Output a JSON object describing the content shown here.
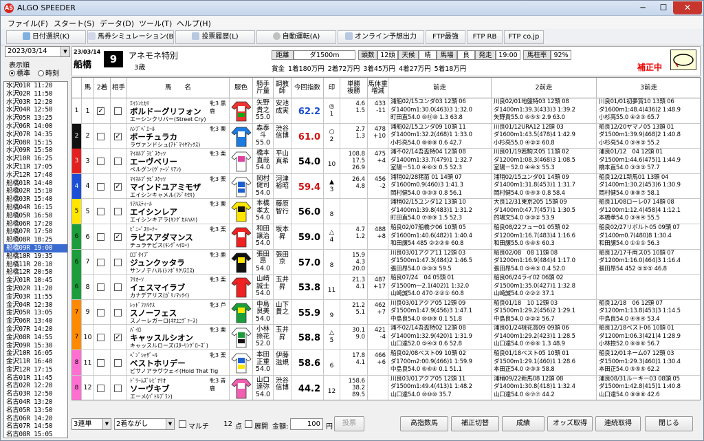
{
  "window": {
    "title": "ALGO SPEEDER",
    "logo": "AS",
    "min": "─",
    "max": "☐",
    "close": "✕"
  },
  "menu": [
    "ファイル(F)",
    "スタート(S)",
    "データ(D)",
    "ツール(T)",
    "ヘルプ(H)"
  ],
  "toolbar": [
    "日付選択(K)",
    "馬券シミュレーション(B)",
    "投票履歴(L)",
    "自動運転(A)",
    "オンライン予想出力",
    "FTP最強",
    "FTP RB",
    "FTP co.jp"
  ],
  "left": {
    "date": "2023/03/14",
    "order_label": "表示順",
    "radio_std": "標準",
    "radio_time": "時刻",
    "races": [
      "水沢01R 11:20",
      "水沢02R 11:50",
      "水沢03R 12:20",
      "水沢04R 12:50",
      "水沢05R 13:25",
      "水沢06R 14:00",
      "水沢07R 14:35",
      "水沢08R 15:15",
      "水沢09R 15:50",
      "水沢10R 16:25",
      "水沢11R 17:05",
      "水沢12R 17:40",
      "船橋01R 14:40",
      "船橋02R 15:10",
      "船橋03R 15:40",
      "船橋04R 16:15",
      "船橋05R 16:50",
      "船橋06R 17:20",
      "船橋07R 17:50",
      "船橋08R 18:25",
      "船橋09R 19:00",
      "船橋10R 19:35",
      "船橋11R 20:10",
      "船橋12R 20:50",
      "金沢01R 10:45",
      "金沢02R 11:20",
      "金沢03R 11:55",
      "金沢04R 12:30",
      "金沢05R 13:05",
      "金沢06R 13:40",
      "金沢07R 14:20",
      "金沢08R 14:55",
      "金沢09R 15:30",
      "金沢10R 16:05",
      "金沢11R 16:40",
      "金沢12R 17:15",
      "名古01R 11:45",
      "名古02R 12:20",
      "名古03R 12:50",
      "名古04R 13:20",
      "名古05R 13:50",
      "名古06R 14:20",
      "名古07R 14:50",
      "名古08R 15:05"
    ],
    "selected": 20
  },
  "header": {
    "date": "23/03/14",
    "venue": "船橋",
    "race_no": "9",
    "race_name": "アネモネ特別",
    "age": "3歳",
    "k_dist": "距離",
    "v_dist": "ダ1500m",
    "k_heads": "頭数",
    "v_heads": "12頭",
    "k_weather": "天候",
    "v_weather": "晴",
    "k_track": "馬場",
    "v_track": "良",
    "k_start": "発走",
    "v_start": "19:00",
    "k_rate": "馬柱率",
    "v_rate": "92%",
    "prize": "賞金 1着180万円 2着72万円 3着45万円 4着27万円 5着18万円",
    "correction": "補正中"
  },
  "columns": [
    "馬",
    "2着",
    "相手",
    "馬　　名",
    "服色",
    "騎手\n斤量",
    "調教\n師",
    "今回指数",
    "印",
    "単勝\n複勝",
    "馬体重\n増減",
    "前走",
    "2前走",
    "3前走"
  ],
  "horses": [
    {
      "no": "1",
      "wk": "1",
      "ck2": true,
      "ck3": false,
      "sire": "ｴｲｼﾝﾋｶﾘ",
      "sex": "牝3 黒鹿",
      "name": "ボルドーグリフォン",
      "dam": "エーシンクリバー(Street Cry)",
      "jk": "矢野\n貴之\n55.0",
      "tr": "安池\n成実",
      "idx": "62.2",
      "idxc": "#1a4fd0",
      "mk": "◎\n1",
      "od": "4.6\n1.5",
      "wt": "433\n-11",
      "p1": [
        "浦船02/15ユンダ03 12頭 06",
        "ダ1400m1:30.0(463)3 1:32.0",
        "町田直54.0 ⑩⑫⑩ 1.3 63.8"
      ],
      "p2": [
        "川良02/01地盤特03 12頭 08",
        "ダ1400m1:39.3(433)3 1:39.2",
        "矢野貴55.0 ⑥⑤⑤ 2.9 63.0"
      ],
      "p3": [
        "川良01/01初夢賞10 13頭 06",
        "ダ1600m1:48.4(436)2 1:48.9",
        "小杉亮55.0 ④②③ 65.7"
      ],
      "silk": [
        "#e33",
        "#fff",
        "#1a1"
      ]
    },
    {
      "no": "2",
      "wk": "2",
      "ck2": false,
      "ck3": true,
      "sire": "ﾊﾝﾌﾞﾍﾞｴｰﾙ",
      "sex": "牝3 栗",
      "name": "ボーチュラカ",
      "dam": "ラヴァンドシュ(ｱﾄﾞﾏｲﾔﾏｯｸｽ)",
      "jk": "森泰\n斗\n55.0",
      "tr": "渋谷\n信博",
      "idx": "61.0",
      "idxc": "#d01010",
      "mk": "○\n2",
      "od": "2.7\n1.3",
      "wt": "478\n+10",
      "p1": [
        "浦船02/15ユンダ09 10頭 11",
        "ダ1400m1:32.2(468)1 1:33.0",
        "小杉亮54.0 ⑧⑧⑧ 0.6 42.7"
      ],
      "p2": [
        "川良01/12URA12 12頭 03",
        "ダ1600m1:43.5(478)4 1:42.9",
        "小杉亮55.0 ④②② 60.8"
      ],
      "p3": [
        "船良12/20ヤマノ05 13頭 01",
        "ダ1500m1:39.9(468)2 1:40.8",
        "小杉亮54.0 ⑤④③ 55.2"
      ],
      "silk": [
        "#1c7be0",
        "#fff",
        "#1c7be0"
      ]
    },
    {
      "no": "3",
      "wk": "3",
      "ck2": false,
      "ck3": false,
      "sire": "ﾏｲﾈﾙﾌﾞﾗﾋﾞｽｹｯﾂ",
      "sex": "牝3 栗",
      "name": "エーヴベリー",
      "dam": "ペルグン(ｳﾞｧｰｼﾞﾘｱﾝ)",
      "jk": "橋本\n直哉\n54.0",
      "tr": "平山\n真希",
      "idx": "54.0",
      "idxc": "#000",
      "mk": "\n10",
      "od": "108.8\n17.5\n26.9",
      "wt": "475\n+4",
      "p1": [
        "浦不02/14吾盃特04 12頭 08",
        "ダ1400m1:33.7(479)1 1:32.7",
        "室陽－51.0 ④⑥⑤ 0.5 52.3"
      ],
      "p2": [
        "川良01/19若駒ズ05 11頭 02",
        "ダ1200m1:08.3(468)3 1:08.5",
        "室陽－52.0 ④④⑤ 55.3"
      ],
      "p3": [
        "浦良01/12　04 12頭 01",
        "ダ1500m1:44.6(475)1 1:44.9",
        "橋本直54.0 ③③③ 57.7"
      ],
      "silk": [
        "#fff",
        "#e040a0",
        "#fff"
      ]
    },
    {
      "no": "4",
      "wk": "4",
      "ck2": false,
      "ck3": true,
      "sire": "ﾏｲﾈﾙﾌﾞﾗﾋﾞｽｹｯﾂ",
      "sex": "牝3 栗",
      "name": "マインドユアミモザ",
      "dam": "エイシンキャメル(ﾌｼﾞｷｾｷ)",
      "jk": "岡村\n健司\n54.0",
      "tr": "河津\n裕昭",
      "idx": "59.4",
      "idxc": "#d01010",
      "mk": "▲\n3",
      "od": "26.4\n4.8",
      "wt": "456\n-2",
      "p1": [
        "浦稍02/28猪苗 01 14頭 07",
        "ダ1600m0.9(460)3 1:41.3",
        "岡村健54.0 ③③③ 0.8 56.1"
      ],
      "p2": [
        "浦稍02/15ユンダ01 14頭 09",
        "ダ1400m1:31.8(453)1 1:31.7",
        "岡村健54.0 ⑤④③ 0.8 58.4"
      ],
      "p3": [
        "船良12/21新馬01 13頭 04",
        "ダ1400m1:30.2(453)6 1:30.9",
        "岡村健54.0 ⑧⑧⑦ 58.1"
      ],
      "silk": [
        "#fff",
        "#1c5fd0",
        "#1c5fd0"
      ]
    },
    {
      "no": "5",
      "wk": "5",
      "ck2": false,
      "ck3": false,
      "sire": "ﾘｱﾙｽﾃｨｰﾙ",
      "sex": "牝3 栗",
      "name": "エイシンレア",
      "dam": "エイシンキアラ(ｷﾝｸﾞｶﾒﾊﾒﾊ)",
      "jk": "本橋\n孝太\n54.0",
      "tr": "藤原\n智行",
      "idx": "56.0",
      "idxc": "#000",
      "mk": "\n8",
      "od": "\n",
      "wt": "\n",
      "p1": [
        "浦稍02/15ユンダ12 13頭 10",
        "ダ1400m1:39.8(483)1 1:31.2",
        "町田直54.0 ⑦⑨⑨ 1.5 52.3"
      ],
      "p2": [
        "大良12/31東京205 15頭 09",
        "ダ1400m0:47.7(457)1 1:30.5",
        "的場文54.0 ③③② 53.9"
      ],
      "p3": [
        "船良11/08ローレ07 14頭 08",
        "ダ1200m1:12.4(458)4 1:12.1",
        "本橋孝54.0 ③④④ 55.5"
      ],
      "silk": [
        "#ffe600",
        "#111",
        "#ffe600"
      ]
    },
    {
      "no": "6",
      "wk": "6",
      "ck2": false,
      "ck3": true,
      "sire": "ﾋﾟﾆｰﾞｽﾘｰﾅｰ",
      "sex": "牝3 栗",
      "name": "ラピスアダマンス",
      "dam": "チュラテピス(ｷﾝｸﾞﾍｲﾛｰ)",
      "jk": "和田\n譲治\n54.0",
      "tr": "坂本\n昇",
      "idx": "59.0",
      "idxc": "#000",
      "mk": "△\n4",
      "od": "4.7\n1.2",
      "wt": "488\n+8",
      "p1": [
        "船良02/07船橋ク06 10頭 05",
        "ダ1600m1:40.6(482)1 1:40.4",
        "和田譲54 485 ②②②⑨ 60.8"
      ],
      "p2": [
        "船良08/22フュー01 05頭 02",
        "ダ1200m1:16.7(483)4 1:16.6",
        "和田譲55.0 ⑤④⑤ 60.3"
      ],
      "p3": [
        "船良02/27リボルト05 09頭 07",
        "ダ1400m0.7(480)8 1:30.4",
        "和田譲54.0 ①①① 56.3"
      ],
      "silk": [
        "#e22",
        "#fff",
        "#e22"
      ]
    },
    {
      "no": "7",
      "wk": "6",
      "ck2": false,
      "ck3": false,
      "sire": "ﾛｺﾞﾀｲﾌﾟ",
      "sex": "牝3 鹿",
      "name": "ジュンクッタラ",
      "dam": "サンノテハル(ｼﾝﾎﾞﾘｸﾘｽｴｽ)",
      "jk": "張田\n昂\n54.0",
      "tr": "張田\n京",
      "idx": "57.0",
      "idxc": "#000",
      "mk": "\n8",
      "od": "15.9\n4.3\n20.0",
      "wt": "\n",
      "p1": [
        "川良03/01アクア11 12頭 03",
        "ダ1500m1:47.3(484)2 1:46.5",
        "張田昂54.0 ③③③ 59.5"
      ],
      "p2": [
        "船良02/08　08 11頭 08",
        "ダ1200m1:16.9(484)4 1:17.0",
        "張田昂54.0 ⑤④⑤ 0.4 52.0"
      ],
      "p3": [
        "船良12/17千両ス05 10頭 07",
        "ダ1200m1:16.0(464)3 1:16.4",
        "張田昂54 452 ⑤⑤⑤ 46.8"
      ],
      "silk": [
        "#111",
        "#ffe600",
        "#111"
      ]
    },
    {
      "no": "8",
      "wk": "6",
      "ck2": false,
      "ck3": false,
      "sire": "ﾌﾘｵｰｿ",
      "sex": "牝3 栗",
      "name": "イェスマイラブ",
      "dam": "カナデアリス(ｶﾞﾘﾉﾏｯｸｲ)",
      "jk": "山崎\n誠士\n54.0",
      "tr": "玉井\n昇",
      "idx": "53.8",
      "idxc": "#000",
      "mk": "\n11",
      "od": "21.3\n4.1",
      "wt": "487\n+17",
      "p1": [
        "船良07/24　04 05頭 01",
        "ダ1500m一2.1(402)1 1:32.0",
        "山崎誠54.0 470 ②②① 60.8"
      ],
      "p2": [
        "船良06/24ライ02 06頭 02",
        "ダ1500m1:35.0(427)1 1:32.8",
        "山崎誠54.0 ②②② 37.1"
      ],
      "p3": [],
      "silk": [
        "#e22",
        "#e22",
        "#e22"
      ]
    },
    {
      "no": "9",
      "wk": "7",
      "ck2": false,
      "ck3": false,
      "sire": "ﾚｯﾄﾞﾌｧﾙｸｽ",
      "sex": "牝3 芦",
      "name": "スノーフェス",
      "dam": "スノーレガーロ(ﾈｵﾕﾆｳﾞｧｰｽ)",
      "jk": "中島\n良美\n54.0",
      "tr": "山下\n貴之",
      "idx": "55.9",
      "idxc": "#000",
      "mk": "\n9",
      "od": "21.2\n5.1",
      "wt": "462\n+7",
      "p1": [
        "川良03/01アクア05 12頭 09",
        "ダ1500m1:47.9(456)3 1:47.1",
        "中島良54.0 ⑩⑩⑨ 0.1 51.8"
      ],
      "p2": [
        "船良01/18　10 12頭 03",
        "ダ1500m1:29.2(456)2 1:29.1",
        "中島良54.0 ②②② 56.7"
      ],
      "p3": [
        "船良12/18　06 12頭 07",
        "ダ1200m1:13.8(453)3 1:14.5",
        "中島良54.0 ④④④ 53.4"
      ],
      "silk": [
        "#1a9d3a",
        "#ffe600",
        "#1a9d3a"
      ]
    },
    {
      "no": "10",
      "wk": "7",
      "ck2": false,
      "ck3": true,
      "sire": "ﾊﾟｲﾛ",
      "sex": "牝3 栗",
      "name": "キャッスルシオン",
      "dam": "キャッスルローズ(ｽﾀｰﾘﾝｸﾞﾛｰｽﾞ)",
      "jk": "小林\n捺花\n52.0",
      "tr": "玉井\n昇",
      "idx": "58.8",
      "idxc": "#000",
      "mk": "△\n5",
      "od": "30.1\n9.0",
      "wt": "421\n-4",
      "p1": [
        "浦不02/14吾盃特02 12頭 08",
        "ダ1400m1:32.9(420)1 1:31.9",
        "山口達52.0 ⑤④③ 0.6 52.8"
      ],
      "p2": [
        "浦良01/24桃花賞09 09頭 06",
        "ダ1400m1:29.2(423)1 1:28.5",
        "山口達54.0 ⑦⑥⑥ 1.3 48.9"
      ],
      "p3": [
        "船良12/18ベスト06 10頭 01",
        "ダ1200m1:06.3(421)4 1:28.9",
        "小林捺52.0 ⑥⑥⑥ 56.7"
      ],
      "silk": [
        "#fff",
        "#1a9d3a",
        "#111"
      ]
    },
    {
      "no": "11",
      "wk": "8",
      "ck2": false,
      "ck3": false,
      "sire": "ﾍﾞﾝﾞｼｬｻﾞｰﾙ",
      "sex": "牝3 栗",
      "name": "ベストホリデー",
      "dam": "ピサノアラヴウェイ(Hold That Tig",
      "jk": "本田\n正重\n54.0",
      "tr": "伊藤\n滋規",
      "idx": "58.6",
      "idxc": "#000",
      "mk": "\n6",
      "od": "17.8\n4.1",
      "wt": "466\n+6",
      "p1": [
        "船良02/08ベスト09 10頭 02",
        "ダ1700m2:00.9(466)1 1:59.9",
        "中島良54.0 ⑥⑥④ 0.1 51.1"
      ],
      "p2": [
        "船良01/18ベスト05 10頭 01",
        "ダ1500m1:29.1(460)1 1:28.6",
        "本田正54.0 ②③③ 58.8"
      ],
      "p3": [
        "船良12/01ネーム07 12頭 03",
        "ダ1500m1:29.3(460)1 1:30.4",
        "本田正54.0 ⑤⑤⑤ 62.2"
      ],
      "silk": [
        "#fff",
        "#1c5fd0",
        "#ffe600"
      ]
    },
    {
      "no": "12",
      "wk": "8",
      "ck2": false,
      "ck3": false,
      "sire": "ﾄﾞﾘｰﾑｽﾞﾚﾋﾞﾅﾘｵ",
      "sex": "牝3 青鹿",
      "name": "ソーヴキブ",
      "dam": "エーメ(ﾊﾟﾄﾙﾌﾞﾗﾝ)",
      "jk": "山口\n達弥\n54.0",
      "tr": "渋谷\n信博",
      "idx": "44.2",
      "idxc": "#000",
      "mk": "\n12",
      "od": "158.6\n38.2\n89.5",
      "wt": "\n",
      "p1": [
        "川良03/01アクア05 12頭 11",
        "ダ1500m1:49.4(413)1 1:48.2",
        "山口達54.0 ⑩⑩⑩ 35.7"
      ],
      "p2": [
        "浦稍09/22新馬08 12頭 08",
        "ダ1400m1:30.8(418)1 1:32.4",
        "山口達54.0 ⑥⑦⑦ 44.2"
      ],
      "p3": [
        "浦良08/31ルーキー03 08頭 05",
        "ダ1500m1:42.8(415)1 1:40.8",
        "山口達54.0 ⑧⑧⑧ 42.6"
      ],
      "silk": [
        "#f060b0",
        "#fff",
        "#f060b0"
      ]
    }
  ],
  "waku_colors": {
    "1": "#ffffff",
    "2": "#111111",
    "3": "#e32020",
    "4": "#1c4fd8",
    "5": "#ffe600",
    "6": "#1a9d3a",
    "7": "#ff8a00",
    "8": "#ff6fd2"
  },
  "bottom": {
    "bet": "3連単",
    "combo": "2着ながし",
    "multi": "マルチ",
    "points": "12",
    "points_unit": "点",
    "expand": "展開",
    "amount_label": "金額:",
    "amount": "100",
    "amount_unit": "円",
    "vote": "投票",
    "btn1": "高指数馬",
    "btn2": "補正切替",
    "btn3": "成績",
    "btn4": "オッズ取得",
    "btn5": "連続取得",
    "btn6": "閉じる"
  }
}
